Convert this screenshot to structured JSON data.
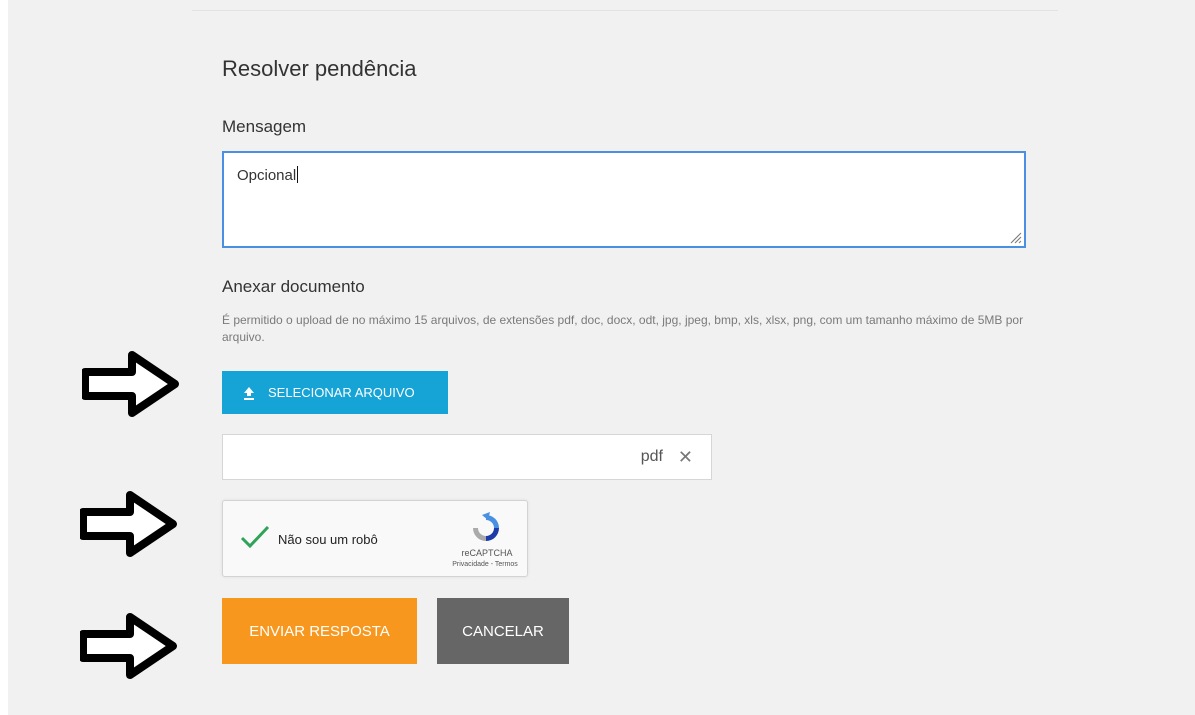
{
  "form": {
    "title": "Resolver pendência",
    "message_label": "Mensagem",
    "message_value": "Opcional",
    "attach_label": "Anexar documento",
    "attach_help": "É permitido o upload de no máximo 15 arquivos, de extensões pdf, doc, docx, odt, jpg, jpeg, bmp, xls, xlsx, png, com um tamanho máximo de 5MB por arquivo.",
    "select_file_label": "SELECIONAR ARQUIVO",
    "file_extension": "pdf",
    "remove_symbol": "✕"
  },
  "captcha": {
    "label": "Não sou um robô",
    "brand": "reCAPTCHA",
    "links": "Privacidade - Termos"
  },
  "actions": {
    "send_label": "ENVIAR RESPOSTA",
    "cancel_label": "CANCELAR"
  },
  "colors": {
    "primary_blue": "#16a3d6",
    "send_orange": "#f7971e",
    "cancel_gray": "#666666",
    "focus_border": "#4a90e2",
    "check_green": "#2fa35a"
  },
  "icons": [
    "upload-icon",
    "close-icon",
    "check-icon",
    "recaptcha-logo-icon",
    "arrow-right-icon",
    "resize-grip-icon"
  ]
}
